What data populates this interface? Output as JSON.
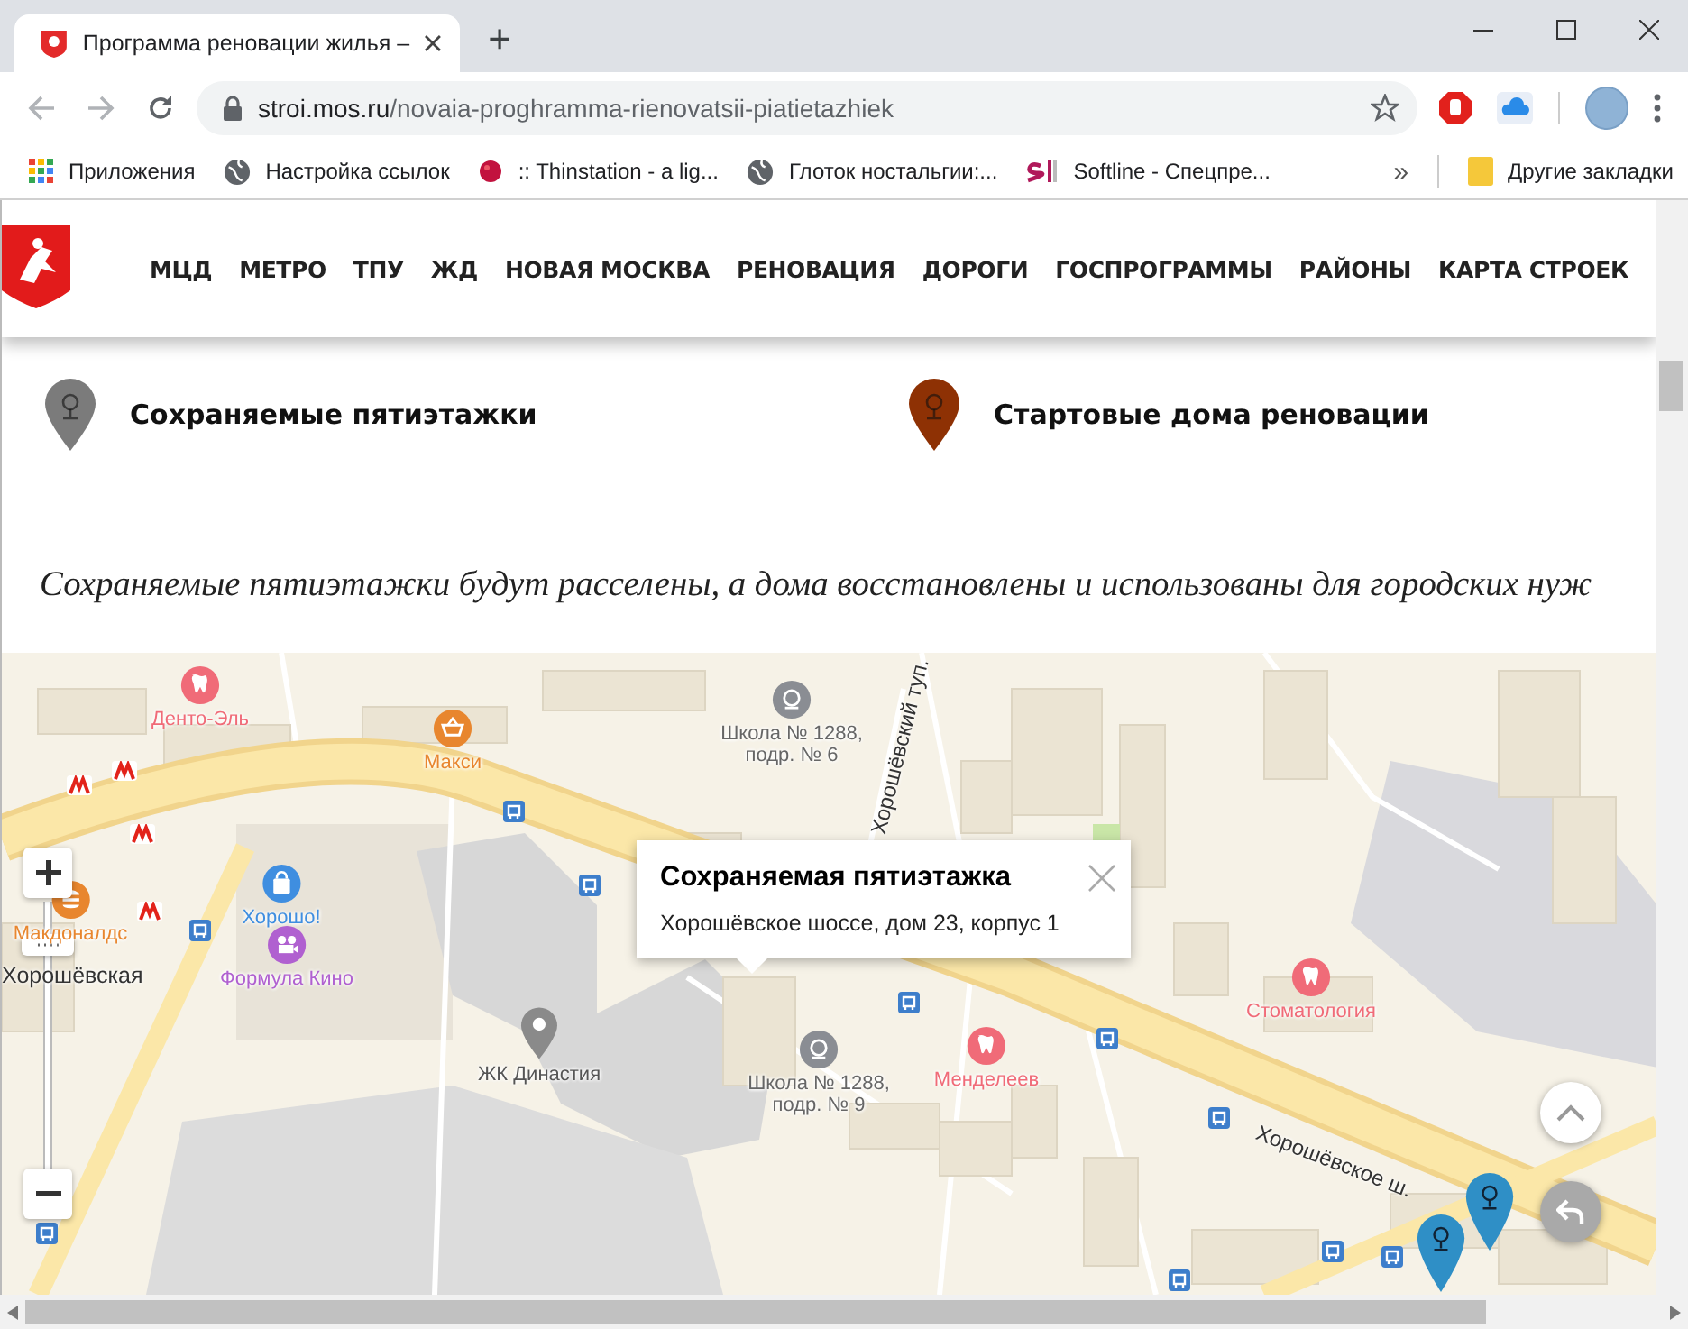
{
  "browser": {
    "tab": {
      "title": "Программа реновации жилья –",
      "selected": true
    },
    "new_tab": "+",
    "address": {
      "domain": "stroi.mos.ru",
      "path": "/novaia-proghramma-rienovatsii-piatietazhiek"
    },
    "bookmarks": [
      {
        "label": "Приложения",
        "kind": "apps"
      },
      {
        "label": "Настройка ссылок",
        "kind": "globe"
      },
      {
        "label": ":: Thinstation - a lig...",
        "kind": "berry"
      },
      {
        "label": "Глоток ностальгии:...",
        "kind": "globe"
      },
      {
        "label": "Softline - Спецпре...",
        "kind": "softline"
      }
    ],
    "overflow": "»",
    "other_bookmarks": "Другие закладки"
  },
  "site_nav": [
    "МЦД",
    "МЕТРО",
    "ТПУ",
    "ЖД",
    "НОВАЯ МОСКВА",
    "РЕНОВАЦИЯ",
    "ДОРОГИ",
    "ГОСПРОГРАММЫ",
    "РАЙОНЫ",
    "КАРТА СТРОЕК"
  ],
  "legend": [
    {
      "label": "Сохраняемые пятиэтажки",
      "color": "#7b7b7b"
    },
    {
      "label": "Стартовые дома реновации",
      "color": "#8e3104"
    }
  ],
  "intro": "Сохраняемые пятиэтажки будут расселены, а дома восстановлены и использованы для городских нуж",
  "map": {
    "places": [
      {
        "label": "Денто-Эль",
        "kind": "tooth",
        "color": "#f06b78"
      },
      {
        "label": "Макси",
        "kind": "basket",
        "color": "#e8862e"
      },
      {
        "label": "Школа № 1288, подр. № 6",
        "kind": "school",
        "color": "#8a8d93"
      },
      {
        "label": "Макдоналдс",
        "kind": "food",
        "color": "#e8862e"
      },
      {
        "label": "Хорошо!",
        "kind": "bag",
        "color": "#3f8ee0"
      },
      {
        "label": "Хорошёвская",
        "kind": "station",
        "color": "#333333"
      },
      {
        "label": "Формула Кино",
        "kind": "film",
        "color": "#b060d0"
      },
      {
        "label": "ЖК Династия",
        "kind": "pin",
        "color": "#8a8a8a"
      },
      {
        "label": "Школа № 1288, подр. № 9",
        "kind": "school",
        "color": "#8a8d93"
      },
      {
        "label": "Менделеев",
        "kind": "tooth",
        "color": "#f06b78"
      },
      {
        "label": "Стоматология",
        "kind": "tooth",
        "color": "#f06b78"
      }
    ],
    "streets": [
      "Хорошёвский туп.",
      "Хорошёвское ш."
    ],
    "popup": {
      "title": "Сохраняемая пятиэтажка",
      "address": "Хорошёвское шоссе, дом 23, корпус 1"
    }
  }
}
